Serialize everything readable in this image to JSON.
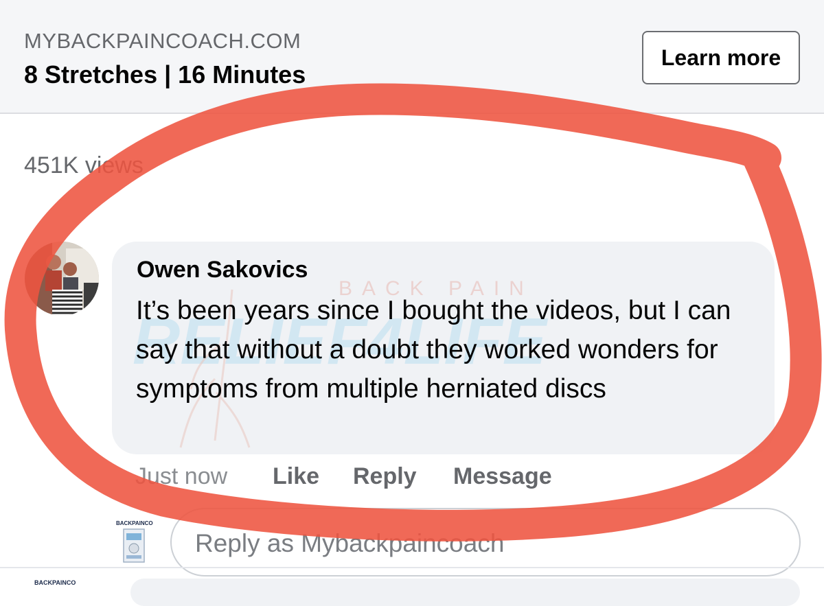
{
  "ad": {
    "domain": "MYBACKPAINCOACH.COM",
    "title": "8 Stretches | 16 Minutes",
    "cta_label": "Learn more"
  },
  "post": {
    "views": "451K views"
  },
  "comment": {
    "author": "Owen Sakovics",
    "text": "It’s been years since I bought the videos, but I can say that without a doubt they worked wonders for symptoms from multiple herniated discs",
    "timestamp": "Just now",
    "actions": {
      "like": "Like",
      "reply": "Reply",
      "message": "Message"
    }
  },
  "watermark": {
    "line1": "BACK PAIN",
    "line2": "RELIEF4LIFE"
  },
  "page_logo_text": "BACKPAINCO",
  "reply_input": {
    "placeholder": "Reply as Mybackpaincoach",
    "value": ""
  },
  "icons": [
    "avatar-photo",
    "page-logo-icon"
  ],
  "colors": {
    "annotation_stroke": "#ee5440",
    "bubble_bg": "#f0f2f5",
    "secondary_text": "#65676b"
  }
}
